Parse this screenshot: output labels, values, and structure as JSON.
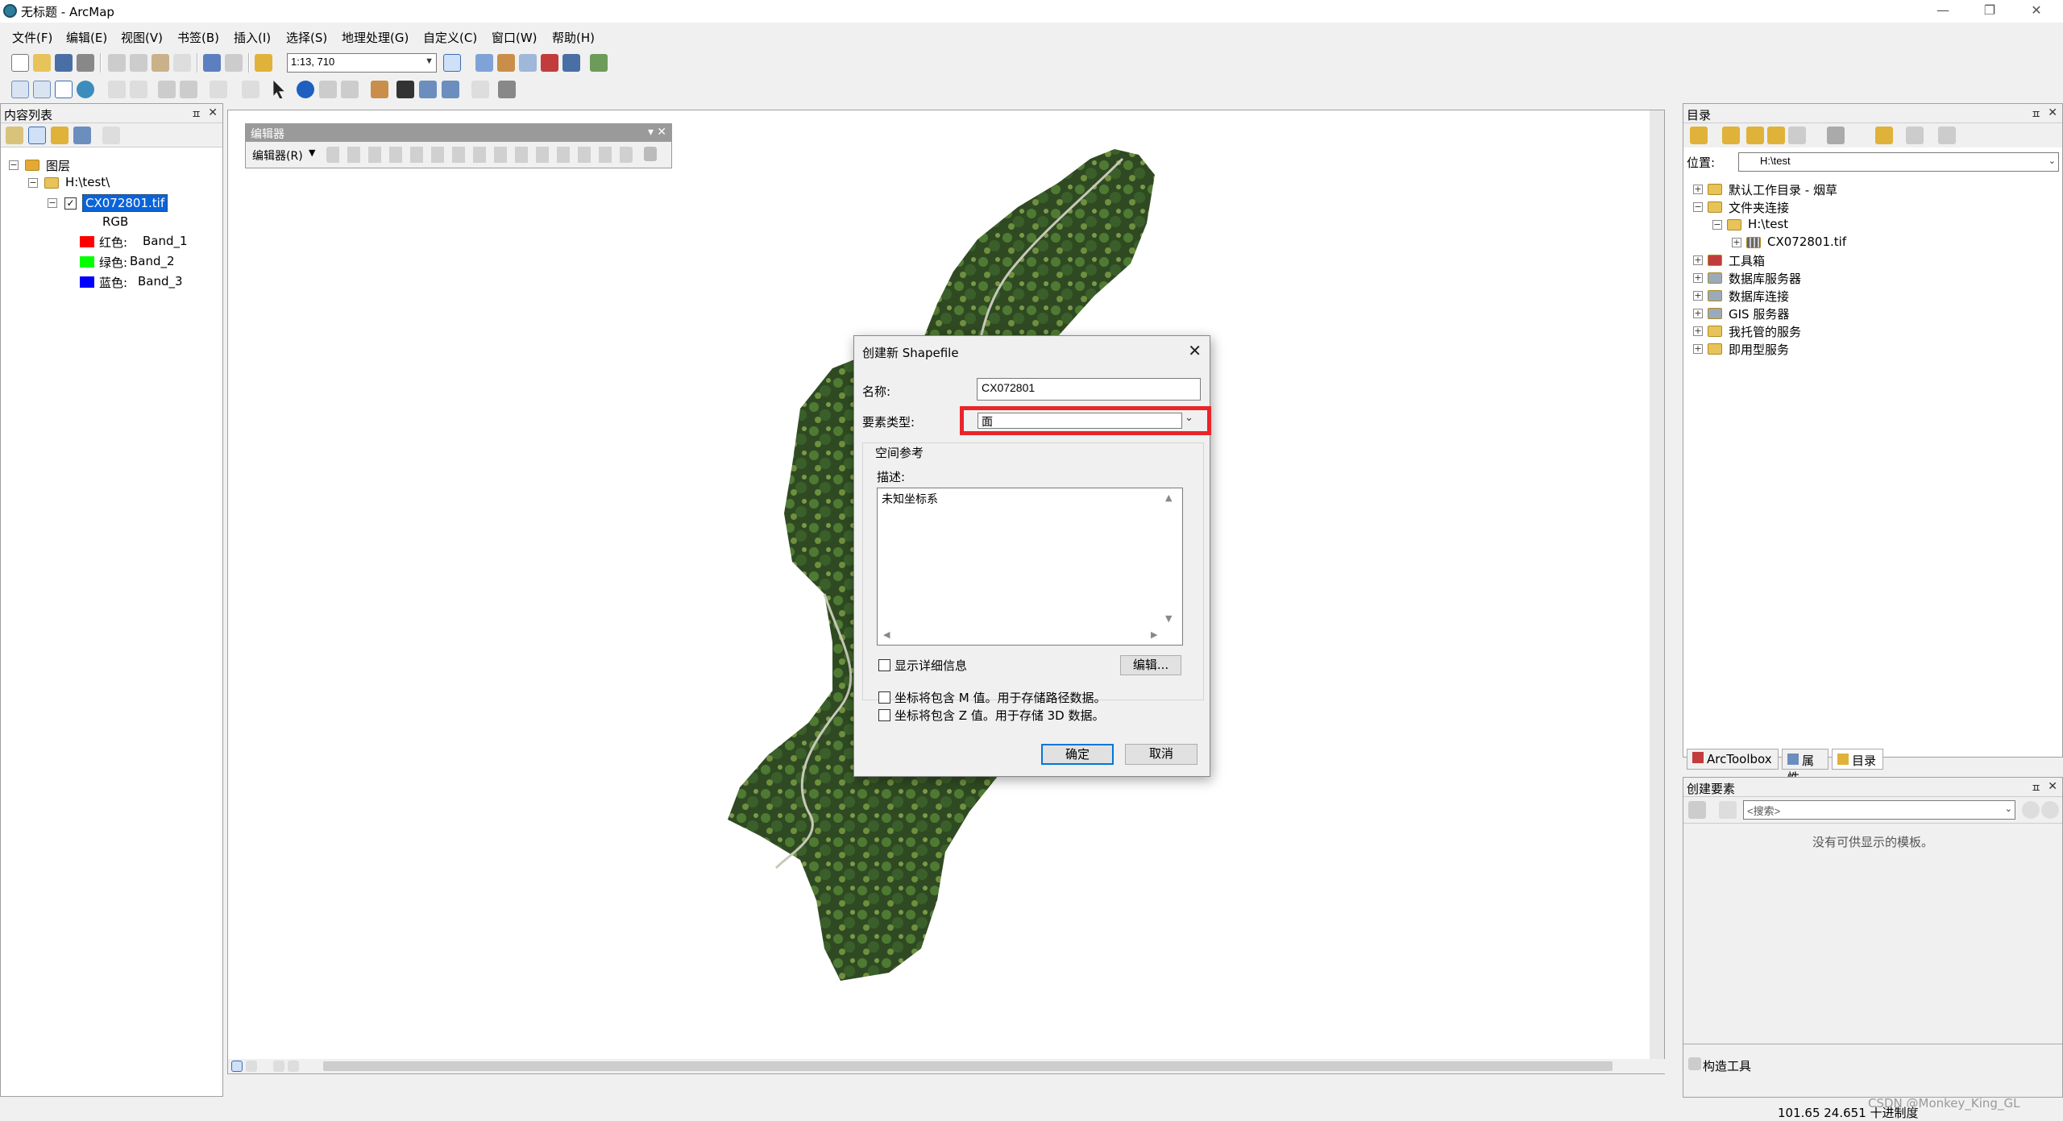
{
  "window": {
    "title": "无标题 - ArcMap",
    "controls": [
      "—",
      "❐",
      "✕"
    ]
  },
  "menu": [
    "文件(F)",
    "编辑(E)",
    "视图(V)",
    "书签(B)",
    "插入(I)",
    "选择(S)",
    "地理处理(G)",
    "自定义(C)",
    "窗口(W)",
    "帮助(H)"
  ],
  "toolbar": {
    "scale": "1:13, 710"
  },
  "toc": {
    "title": "内容列表",
    "layers_label": "图层",
    "folder": "H:\\test\\",
    "layer": "CX072801.tif",
    "rgb": "RGB",
    "bands": [
      {
        "channel": "红色:",
        "band": "Band_1",
        "color": "#ff0000"
      },
      {
        "channel": "绿色:",
        "band": "Band_2",
        "color": "#00ff00"
      },
      {
        "channel": "蓝色:",
        "band": "Band_3",
        "color": "#0000ff"
      }
    ]
  },
  "editor_toolbar": {
    "title": "编辑器",
    "menu": "编辑器(R)"
  },
  "dialog": {
    "title": "创建新 Shapefile",
    "name_label": "名称:",
    "name_value": "CX072801",
    "type_label": "要素类型:",
    "type_value": "面",
    "spatial_ref_label": "空间参考",
    "desc_label": "描述:",
    "desc_value": "未知坐标系",
    "show_details": "显示详细信息",
    "edit_button": "编辑...",
    "m_values": "坐标将包含 M 值。用于存储路径数据。",
    "z_values": "坐标将包含 Z 值。用于存储 3D 数据。",
    "ok": "确定",
    "cancel": "取消"
  },
  "catalog": {
    "title": "目录",
    "location_label": "位置:",
    "location_value": "H:\\test",
    "items": [
      {
        "label": "默认工作目录 - 烟草",
        "level": 0,
        "expander": "+"
      },
      {
        "label": "文件夹连接",
        "level": 0,
        "expander": "−"
      },
      {
        "label": "H:\\test",
        "level": 1,
        "expander": "−"
      },
      {
        "label": "CX072801.tif",
        "level": 2,
        "expander": "+"
      },
      {
        "label": "工具箱",
        "level": 0,
        "expander": "+"
      },
      {
        "label": "数据库服务器",
        "level": 0,
        "expander": "+"
      },
      {
        "label": "数据库连接",
        "level": 0,
        "expander": "+"
      },
      {
        "label": "GIS 服务器",
        "level": 0,
        "expander": "+"
      },
      {
        "label": "我托管的服务",
        "level": 0,
        "expander": "+"
      },
      {
        "label": "即用型服务",
        "level": 0,
        "expander": "+"
      }
    ],
    "tabs": [
      "ArcToolbox",
      "属性",
      "目录"
    ]
  },
  "create_features": {
    "title": "创建要素",
    "search_placeholder": "<搜索>",
    "empty_message": "没有可供显示的模板。",
    "construct_tools": "构造工具"
  },
  "status": {
    "coords": "101.65  24.651 十进制度",
    "watermark": "CSDN @Monkey_King_GL"
  }
}
